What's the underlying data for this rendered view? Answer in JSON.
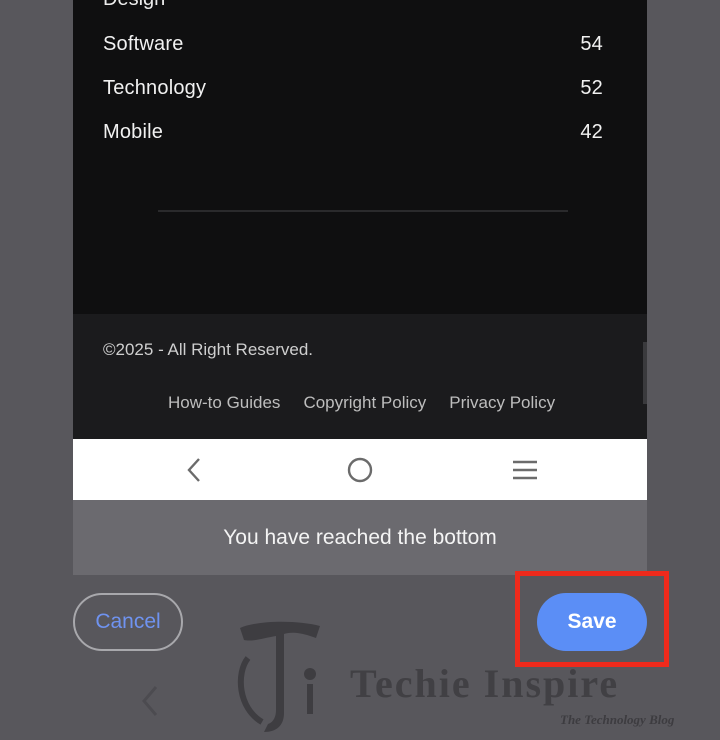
{
  "categories": {
    "partial_row_label": "Design",
    "items": [
      {
        "label": "Software",
        "count": "54"
      },
      {
        "label": "Technology",
        "count": "52"
      },
      {
        "label": "Mobile",
        "count": "42"
      }
    ]
  },
  "footer": {
    "copyright": "©2025 - All Right Reserved.",
    "links": [
      "How-to Guides",
      "Copyright Policy",
      "Privacy Policy"
    ]
  },
  "navbar": {
    "icons": [
      "back-icon",
      "home-icon",
      "recents-icon"
    ]
  },
  "toast": {
    "message": "You have reached the bottom"
  },
  "dialog": {
    "cancel_label": "Cancel",
    "save_label": "Save"
  },
  "watermark": {
    "brand": "Techie Inspire",
    "tagline": "The Technology Blog"
  },
  "colors": {
    "accent": "#5b8ef6",
    "highlight": "#ee2a1c",
    "cancel_text": "#6f93f0"
  }
}
